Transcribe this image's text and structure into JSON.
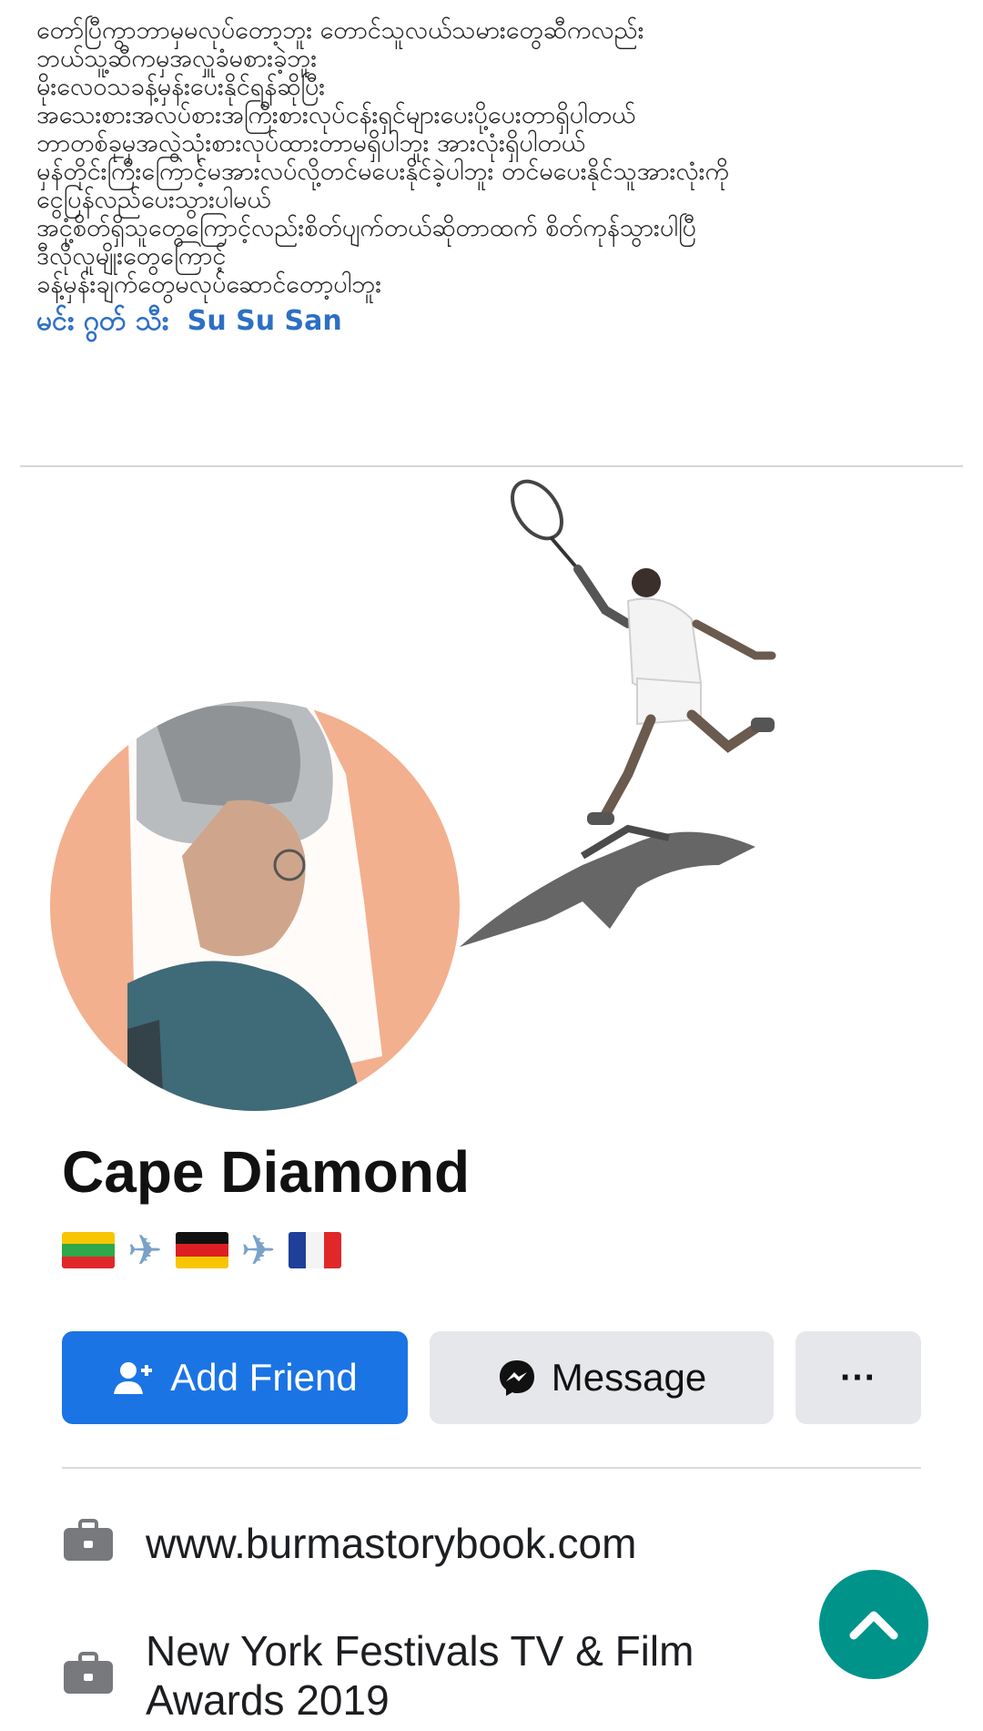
{
  "post": {
    "lines": [
      "တော်ပြီကွာဘာမှမလုပ်တော့ဘူး တောင်သူလယ်သမားတွေဆီကလည်း",
      "ဘယ်သူ့ဆီကမှအလှူခံမစားခဲ့ဘူး",
      "မိုးလေဝသခန့်မှန်းပေးနိုင်ရန်ဆိုပြီး",
      "အသေးစားအလပ်စားအကြီးစားလုပ်ငန်းရှင်များပေးပို့ပေးတာရှိပါတယ်",
      "ဘာတစ်ခုမှအလွဲသုံးစားလုပ်ထားတာမရှိပါဘူး အားလုံးရှိပါတယ်",
      "မှန်တိုင်းကြီးကြောင့်မအားလပ်လို့တင်မပေးနိုင်ခဲ့ပါဘူး တင်မပေးနိုင်သူအားလုံးကို",
      "ငွေပြန်လည်ပေးသွားပါမယ်",
      "အငုံ့စိတ်ရှိသူတွေကြောင့်လည်းစိတ်ပျက်တယ်ဆိုတာထက် စိတ်ကုန်သွားပါပြီ",
      "ဒီလိုလူမျိုးတွေကြောင့်",
      "ခန့်မှန်းချက်တွေမလုပ်ဆောင်တော့ပါဘူး"
    ],
    "tags": [
      "မင်း ဂွတ် သီး",
      "Su Su San"
    ]
  },
  "profile": {
    "name": "Cape Diamond",
    "flags": [
      "myanmar-flag",
      "airplane",
      "germany-flag",
      "airplane",
      "france-flag"
    ],
    "plane_glyph": "✈"
  },
  "actions": {
    "add_friend": "Add Friend",
    "message": "Message",
    "more": "···"
  },
  "info": {
    "website": "www.burmastorybook.com",
    "award": "New York Festivals TV & Film Awards 2019"
  },
  "colors": {
    "primary_blue": "#1b74e4",
    "tag_blue": "#2d6fc4",
    "scroll_top_teal": "#00938a",
    "avatar_background": "#f2b08f"
  }
}
